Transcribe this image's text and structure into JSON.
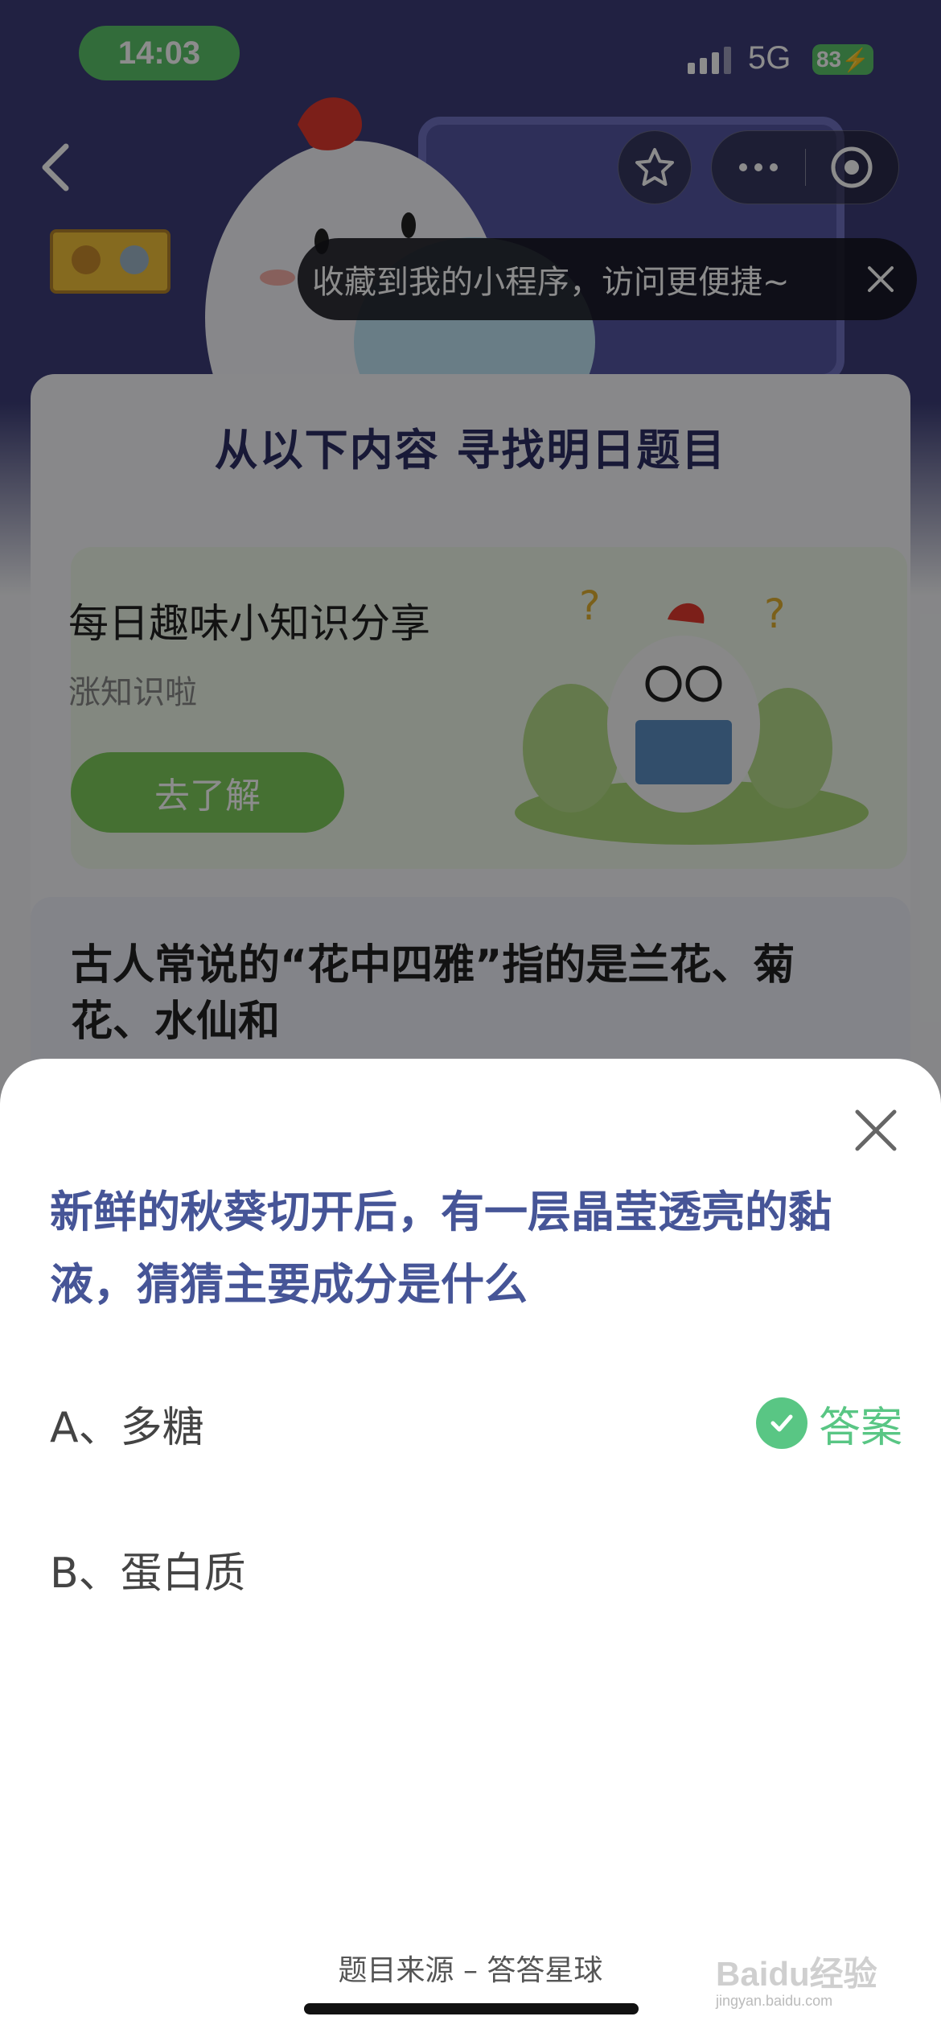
{
  "status_bar": {
    "time": "14:03",
    "network": "5G",
    "battery": "83"
  },
  "mini_program_bar": {
    "favorite_hint": "收藏到我的小程序，访问更便捷~"
  },
  "background": {
    "main_title": "从以下内容  寻找明日题目",
    "knowledge_card": {
      "title": "每日趣味小知识分享",
      "subtitle": "涨知识啦",
      "button": "去了解"
    },
    "question_card": {
      "text": "古人常说的“花中四雅”指的是兰花、菊花、水仙和"
    }
  },
  "sheet": {
    "question": "新鲜的秋葵切开后，有一层晶莹透亮的黏液，猜猜主要成分是什么",
    "options": [
      {
        "label": "A、多糖",
        "answer_tag": "答案"
      },
      {
        "label": "B、蛋白质"
      }
    ],
    "source": "题目来源 – 答答星球"
  },
  "watermark": {
    "text": "Baidu经验",
    "sub": "jingyan.baidu.com"
  },
  "colors": {
    "accent_green": "#59c684",
    "question_blue": "#465597",
    "hero_purple": "#3c3d78"
  }
}
